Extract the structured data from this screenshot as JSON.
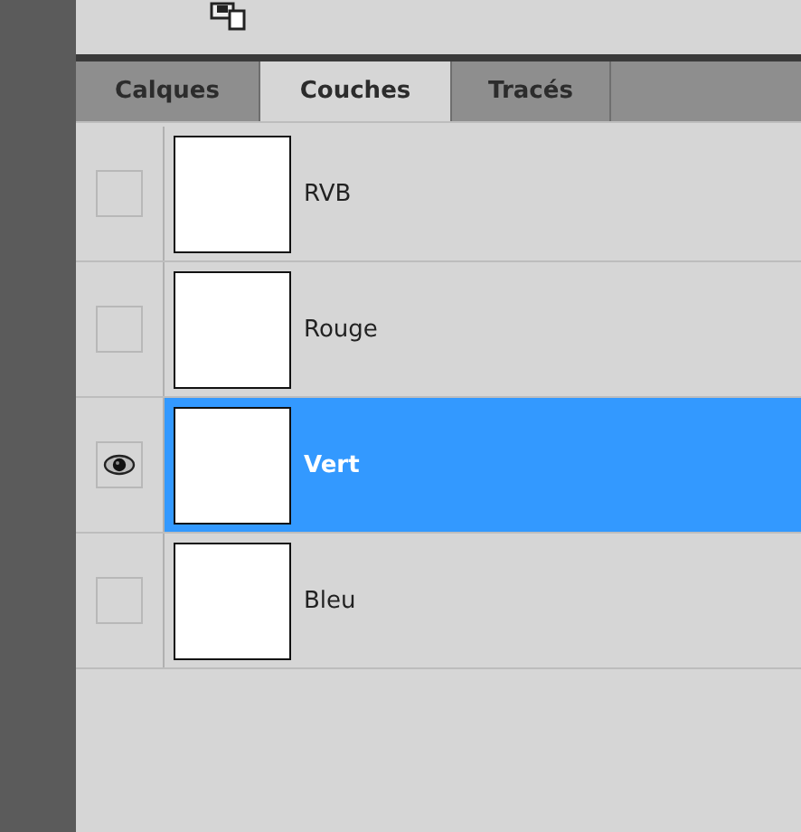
{
  "tabs": [
    {
      "label": "Calques",
      "selected": false
    },
    {
      "label": "Couches",
      "selected": true
    },
    {
      "label": "Tracés",
      "selected": false
    }
  ],
  "channels": [
    {
      "name": "RVB",
      "visible": false,
      "selected": false
    },
    {
      "name": "Rouge",
      "visible": false,
      "selected": false
    },
    {
      "name": "Vert",
      "visible": true,
      "selected": true
    },
    {
      "name": "Bleu",
      "visible": false,
      "selected": false
    }
  ]
}
